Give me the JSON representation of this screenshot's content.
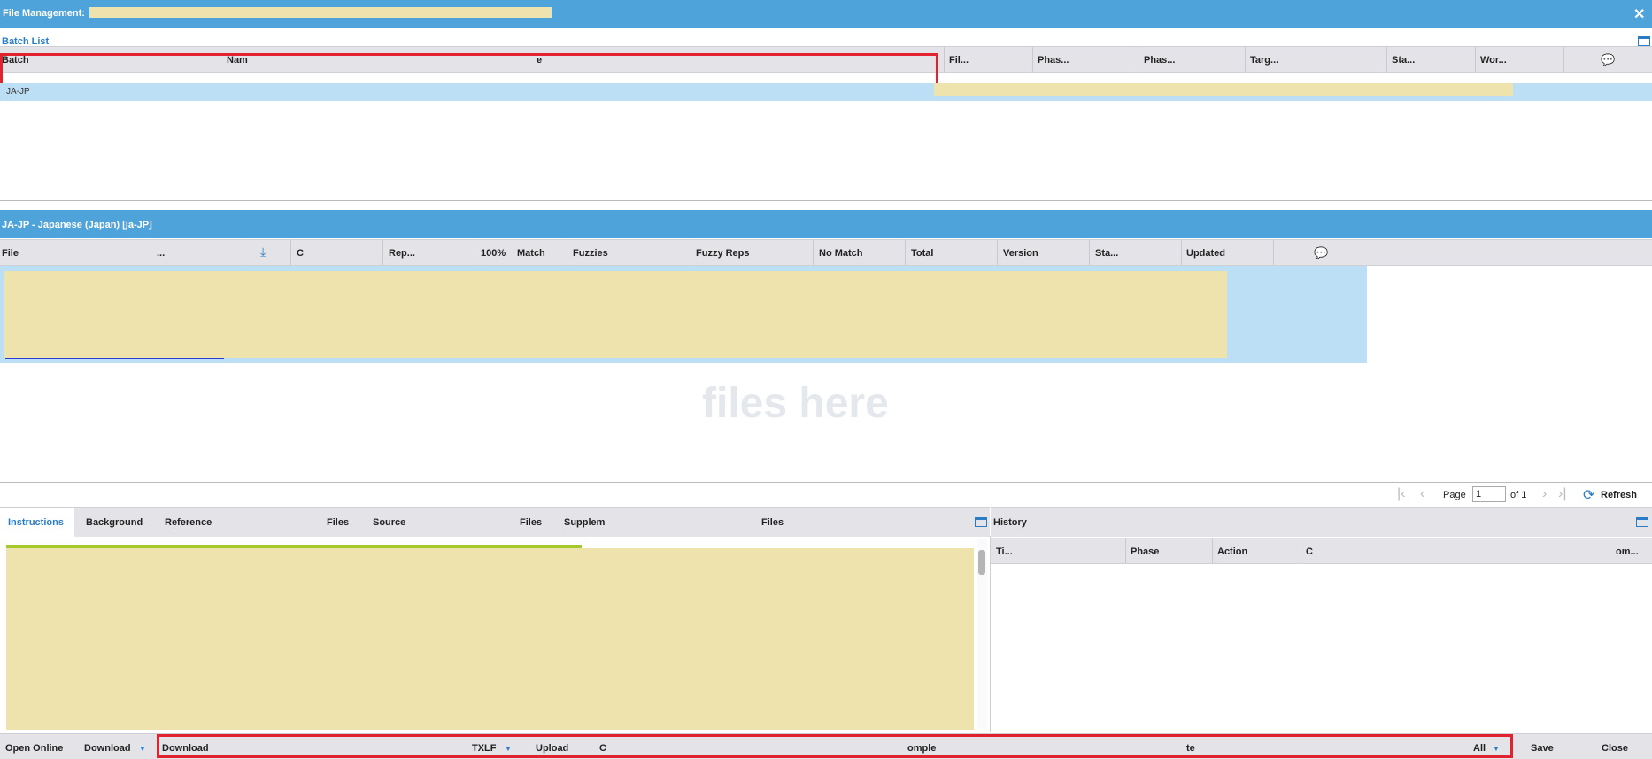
{
  "window": {
    "title": "File Management:",
    "close_glyph": "✕"
  },
  "batch_list": {
    "title": "Batch List",
    "columns": [
      "Batch",
      "Nam",
      "e",
      "Fil...",
      "Phas...",
      "Phas...",
      "Targ...",
      "Sta...",
      "Wor..."
    ],
    "rows": [
      {
        "batch": "JA-JP"
      }
    ]
  },
  "locale_panel": {
    "title": "JA-JP - Japanese (Japan) [ja-JP]",
    "columns": [
      "File",
      "...",
      "C",
      "Rep...",
      "100%",
      "Match",
      "Fuzzies",
      "Fuzzy Reps",
      "No Match",
      "Total",
      "Version",
      "Sta...",
      "Updated"
    ],
    "drop_hint": "files here"
  },
  "pager": {
    "page_label": "Page",
    "page_value": "1",
    "of_label": "of 1",
    "refresh_label": "Refresh"
  },
  "instructions": {
    "tabs": [
      "Instructions",
      "Background",
      "Reference",
      "Files",
      "Source",
      "Files",
      "Supplem",
      "Files"
    ]
  },
  "history": {
    "title": "History",
    "columns": [
      "Ti...",
      "Phase",
      "Action",
      "C",
      "om..."
    ]
  },
  "footer": {
    "open_online": "Open Online",
    "download_menu": "Download",
    "download": "Download",
    "format": "TXLF",
    "upload": "Upload",
    "c": "C",
    "omple": "omple",
    "te": "te",
    "all": "All",
    "save": "Save",
    "close": "Close"
  },
  "colors": {
    "accent": "#4fa3db",
    "highlight_row": "#bcdff6",
    "redaction": "#efe3ad",
    "annotation_red": "#e0232e",
    "header_gray": "#e4e4e8"
  }
}
